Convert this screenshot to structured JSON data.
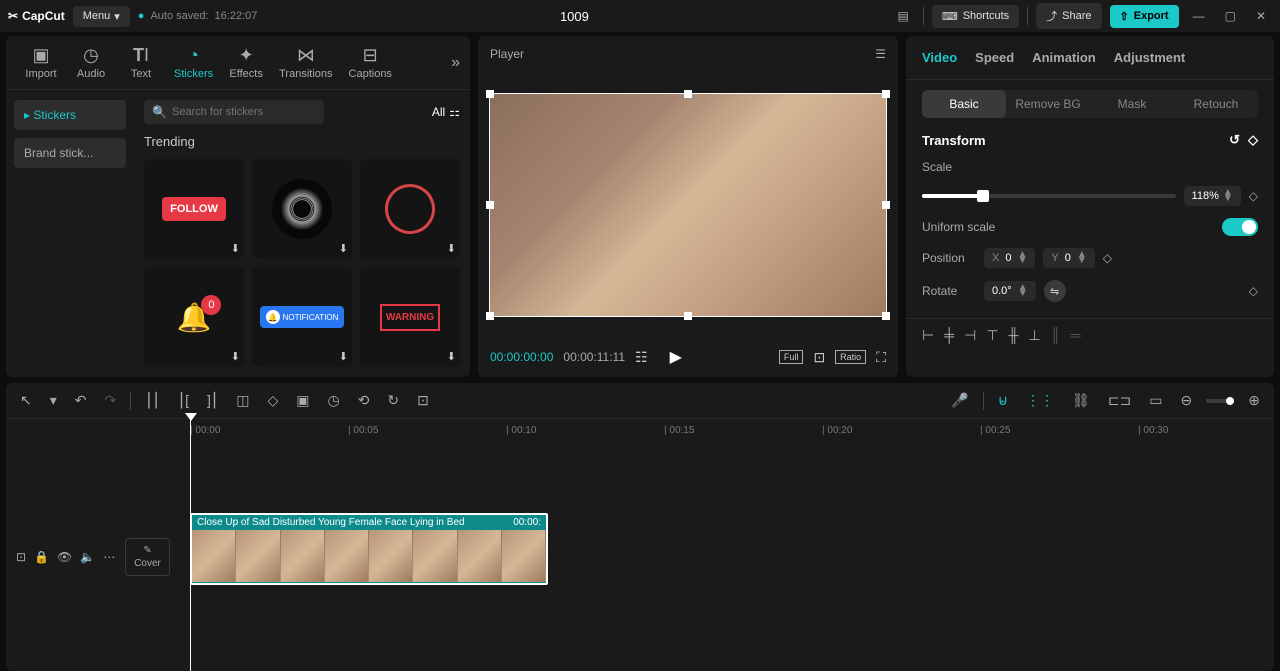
{
  "app_name": "CapCut",
  "menu_label": "Menu",
  "autosave_label": "Auto saved:",
  "autosave_time": "16:22:07",
  "project_title": "1009",
  "top": {
    "shortcuts": "Shortcuts",
    "share": "Share",
    "export": "Export"
  },
  "mode_tabs": [
    {
      "label": "Import"
    },
    {
      "label": "Audio"
    },
    {
      "label": "Text"
    },
    {
      "label": "Stickers"
    },
    {
      "label": "Effects"
    },
    {
      "label": "Transitions"
    },
    {
      "label": "Captions"
    }
  ],
  "active_mode": "Stickers",
  "side_tabs": {
    "stickers": "Stickers",
    "brand": "Brand stick..."
  },
  "search_placeholder": "Search for stickers",
  "all_label": "All",
  "trending_label": "Trending",
  "player": {
    "label": "Player",
    "current": "00:00:00:00",
    "duration": "00:00:11:11",
    "full": "Full",
    "ratio": "Ratio"
  },
  "inspect": {
    "tabs": {
      "video": "Video",
      "speed": "Speed",
      "animation": "Animation",
      "adjustment": "Adjustment"
    },
    "segs": {
      "basic": "Basic",
      "removebg": "Remove BG",
      "mask": "Mask",
      "retouch": "Retouch"
    },
    "transform": "Transform",
    "scale_label": "Scale",
    "scale_value": "118%",
    "uniform_label": "Uniform scale",
    "position_label": "Position",
    "pos_x_label": "X",
    "pos_x": "0",
    "pos_y_label": "Y",
    "pos_y": "0",
    "rotate_label": "Rotate",
    "rotate_value": "0.0°"
  },
  "timeline": {
    "ticks": [
      "00:00",
      "00:05",
      "00:10",
      "00:15",
      "00:20",
      "00:25",
      "00:30"
    ],
    "cover": "Cover",
    "clip_title": "Close Up of Sad Disturbed Young Female Face Lying in Bed",
    "clip_time": "00:00:"
  }
}
